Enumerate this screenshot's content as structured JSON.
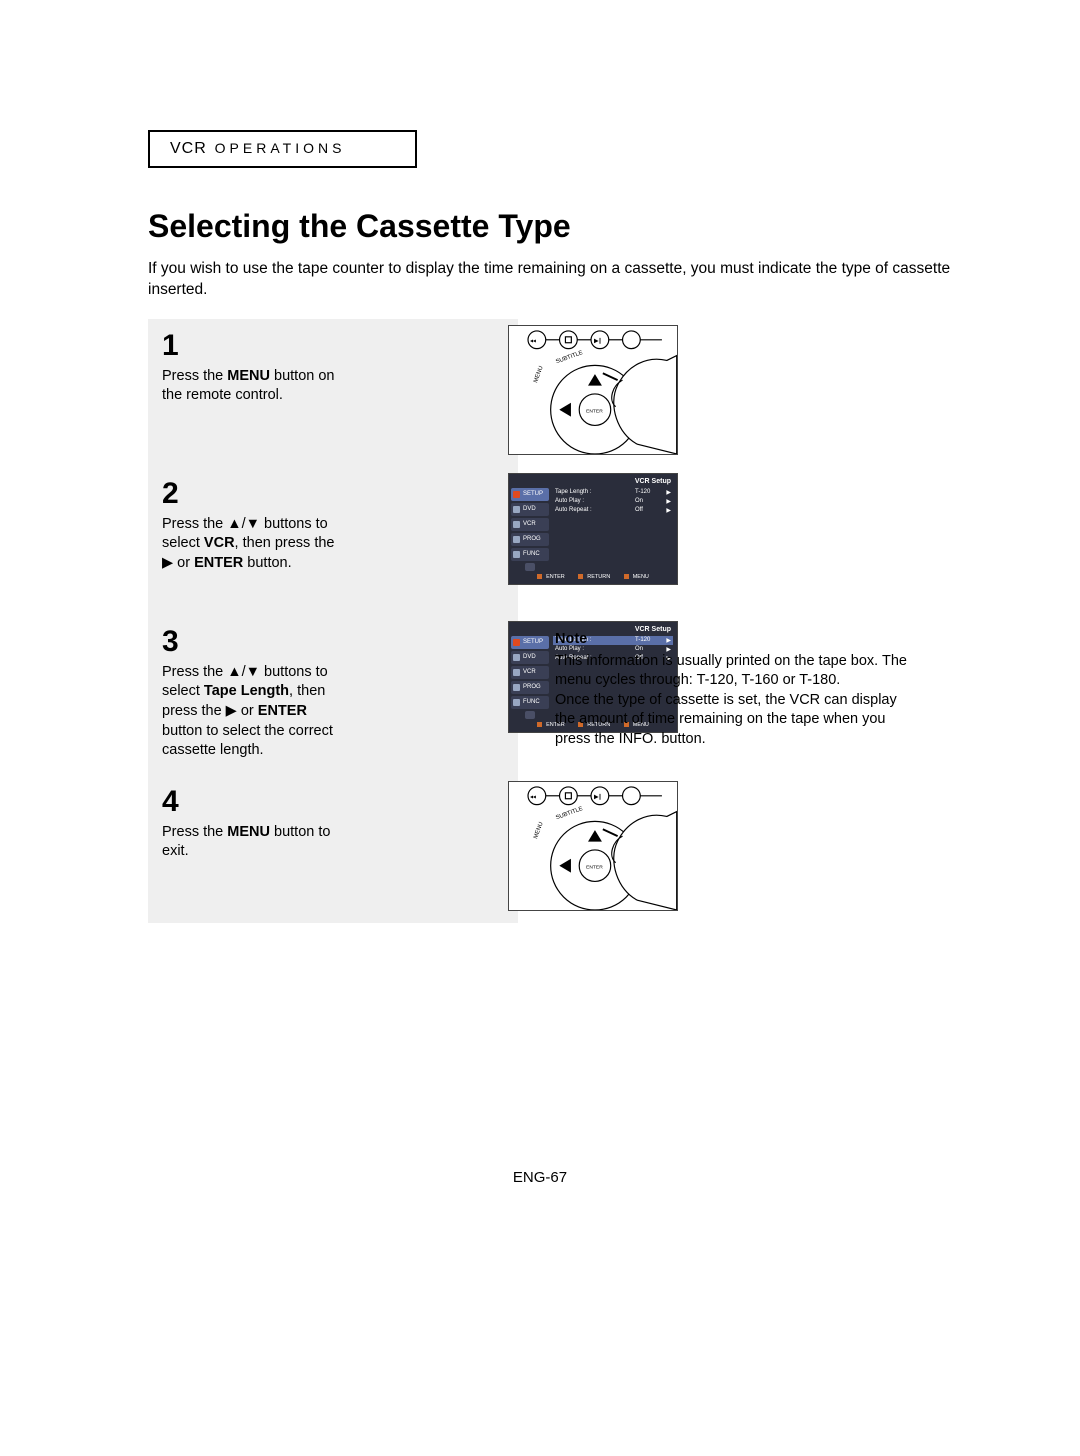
{
  "section_label_prefix": "VCR",
  "section_label_suffix": "OPERATIONS",
  "title": "Selecting the Cassette Type",
  "intro": "If you wish to use the tape counter to display the time remaining on a cassette, you must indicate the type of cassette inserted.",
  "steps": {
    "s1": {
      "num": "1",
      "t1": "Press the ",
      "b1": "MENU",
      "t2": " button on the remote control."
    },
    "s2": {
      "num": "2",
      "t1": "Press the ▲/▼ buttons to select ",
      "b1": "VCR",
      "t2": ", then press the ▶ or ",
      "b2": "ENTER",
      "t3": " button."
    },
    "s3": {
      "num": "3",
      "t1": "Press the ▲/▼ buttons to select ",
      "b1": "Tape Length",
      "t2": ", then press the ▶ or ",
      "b2": "ENTER",
      "t3": " button to select the correct cassette length."
    },
    "s4": {
      "num": "4",
      "t1": "Press the ",
      "b1": "MENU",
      "t2": " button to exit."
    }
  },
  "osd": {
    "title": "VCR Setup",
    "tabs": [
      "SETUP",
      "DVD",
      "VCR",
      "PROG",
      "FUNC"
    ],
    "rows": [
      {
        "k": "Tape Length :",
        "v": "T-120"
      },
      {
        "k": "Auto Play :",
        "v": "On"
      },
      {
        "k": "Auto Repeat :",
        "v": "Off"
      }
    ],
    "footer": [
      "ENTER",
      "RETURN",
      "MENU"
    ]
  },
  "note": {
    "title": "Note",
    "p1": "This information is usually printed on the tape box. The menu cycles through: T-120, T-160 or T-180.",
    "p2": "Once the type of cassette is set, the VCR can display the amount of time remaining on the tape when you press the INFO. button."
  },
  "page_num": "ENG-67"
}
